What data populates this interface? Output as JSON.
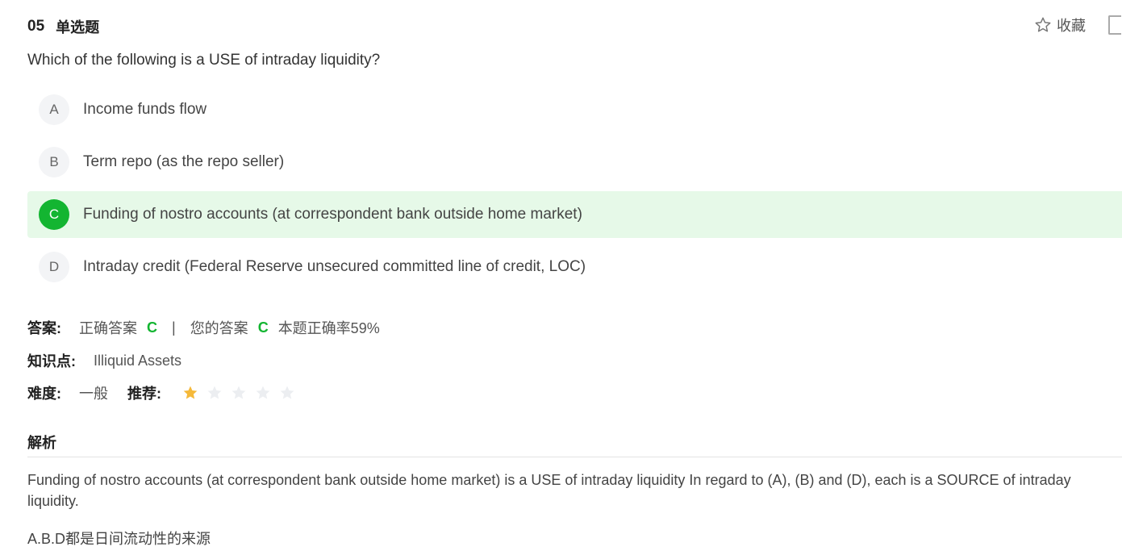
{
  "question": {
    "number": "05",
    "type": "单选题",
    "text": "Which of the following is a USE of intraday liquidity?"
  },
  "actions": {
    "favorite_label": "收藏"
  },
  "options": [
    {
      "letter": "A",
      "text": "Income funds flow",
      "correct": false
    },
    {
      "letter": "B",
      "text": "Term repo (as the repo seller)",
      "correct": false
    },
    {
      "letter": "C",
      "text": "Funding of nostro accounts (at correspondent bank outside home market)",
      "correct": true
    },
    {
      "letter": "D",
      "text": "Intraday credit (Federal Reserve unsecured committed line of credit, LOC)",
      "correct": false
    }
  ],
  "answer": {
    "label": "答案:",
    "correct_label": "正确答案",
    "correct_value": "C",
    "separator": "|",
    "your_label": "您的答案",
    "your_value": "C",
    "rate_text": "本题正确率59%"
  },
  "knowledge": {
    "label": "知识点:",
    "value": "Illiquid Assets"
  },
  "difficulty": {
    "label": "难度:",
    "value": "一般"
  },
  "recommend": {
    "label": "推荐:",
    "rating": 1,
    "max": 5
  },
  "analysis": {
    "title": "解析",
    "text": "Funding of nostro accounts (at correspondent bank outside home market) is a USE of intraday liquidity In regard to (A), (B) and (D), each is a SOURCE of intraday liquidity.",
    "note_cn": "A.B.D都是日间流动性的来源"
  },
  "colors": {
    "correct_green": "#13b531",
    "correct_bg": "#e6f9e8",
    "star_filled": "#f5b93a",
    "star_empty": "#eceef1"
  }
}
